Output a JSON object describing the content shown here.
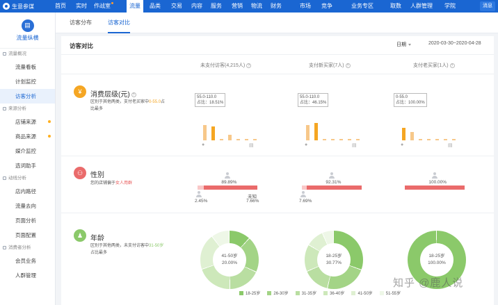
{
  "topnav": {
    "brand": "生意参谋",
    "items": [
      "首页",
      "实时",
      "作战室",
      "流量",
      "品类",
      "交易",
      "内容",
      "服务",
      "营销",
      "物流",
      "财务",
      "市场",
      "竞争",
      "业务专区",
      "取数",
      "人群管理",
      "学院"
    ],
    "active": "流量",
    "user": "消息"
  },
  "sidebar": {
    "title": "流量纵横",
    "groups": [
      {
        "label": "流量概况",
        "items": [
          {
            "label": "流量看板"
          },
          {
            "label": "计划监控"
          },
          {
            "label": "访客分析",
            "active": true
          }
        ]
      },
      {
        "label": "来源分析",
        "items": [
          {
            "label": "店铺来源",
            "dot": true
          },
          {
            "label": "商品来源",
            "dot": true
          },
          {
            "label": "媒介监控"
          },
          {
            "label": "选词助手"
          }
        ]
      },
      {
        "label": "动线分析",
        "items": [
          {
            "label": "店内路径"
          },
          {
            "label": "流量去向"
          },
          {
            "label": "页面分析"
          },
          {
            "label": "页面配置"
          }
        ]
      },
      {
        "label": "消费者分析",
        "items": [
          {
            "label": "会员业务"
          },
          {
            "label": "人群管理"
          }
        ]
      }
    ]
  },
  "tabs": [
    "访客分布",
    "访客对比"
  ],
  "active_tab": "访客对比",
  "panel": {
    "title": "访客对比",
    "date_mode": "日期",
    "date_range": "2020-03-30~2020-04-28",
    "columns": [
      "未支付访客(4,215人)",
      "支付新买家(7人)",
      "支付老买家(1人)"
    ]
  },
  "price": {
    "title": "消费层级(元)",
    "desc_pre": "区别于其他两类，支付老买家中",
    "desc_hl": "0-55.0",
    "desc_post": "占比最多",
    "tooltips": [
      {
        "line1": "55.0-110.0",
        "line2": "占比：18.51%"
      },
      {
        "line1": "55.0-110.0",
        "line2": "占比：46.15%"
      },
      {
        "line1": "0-55.0",
        "line2": "占比：100.00%"
      }
    ],
    "bars": [
      [
        0.55,
        0.5,
        0.05,
        0.2,
        0.04,
        0.04,
        0.02
      ],
      [
        0.55,
        0.63,
        0.05,
        0.04,
        0.02,
        0.03,
        0.02
      ],
      [
        0.45,
        0.3,
        0.06,
        0.06,
        0.04,
        0.03,
        0.02
      ]
    ],
    "highlight_index": [
      1,
      1,
      0
    ]
  },
  "gender": {
    "title": "性别",
    "desc_pre": "您的店铺偏于",
    "desc_hl": "女人用群",
    "cols": [
      {
        "female": "89.89%",
        "male": "2.45%",
        "unknown": "7.66%",
        "unknown_label": "未知",
        "female_share": 0.8989,
        "male_share": 0.0245
      },
      {
        "female": "92.31%",
        "male": "7.69%",
        "female_share": 0.9231,
        "male_share": 0.0769
      },
      {
        "female": "100.00%",
        "female_share": 1.0,
        "male_share": 0
      }
    ]
  },
  "age": {
    "title": "年龄",
    "desc_pre": "区别于其他两类，未支付访客中",
    "desc_hl": "31-50岁",
    "desc_post": "占比最多",
    "donuts": [
      {
        "label": "41-50岁",
        "value": "20.00%",
        "segments": [
          0.12,
          0.2,
          0.18,
          0.2,
          0.2,
          0.1
        ]
      },
      {
        "label": "18-25岁",
        "value": "30.77%",
        "segments": [
          0.3077,
          0.23,
          0.15,
          0.15,
          0.1,
          0.0623
        ]
      },
      {
        "label": "18-25岁",
        "value": "100.00%",
        "segments": [
          1.0,
          0,
          0,
          0,
          0,
          0
        ]
      }
    ],
    "legend": [
      "18-25岁",
      "26-30岁",
      "31-35岁",
      "36-40岁",
      "41-50岁",
      "51-55岁"
    ],
    "colors": [
      "#8bc96a",
      "#a3d486",
      "#b9dea1",
      "#cde8ba",
      "#dff0d2",
      "#eef7e7"
    ]
  },
  "colors": {
    "brand": "#1a66d2",
    "price_accent": "#f5a623",
    "gender_accent": "#ea6b6b",
    "age_accent": "#8bc96a"
  },
  "watermark": "知乎 @鹿人说"
}
